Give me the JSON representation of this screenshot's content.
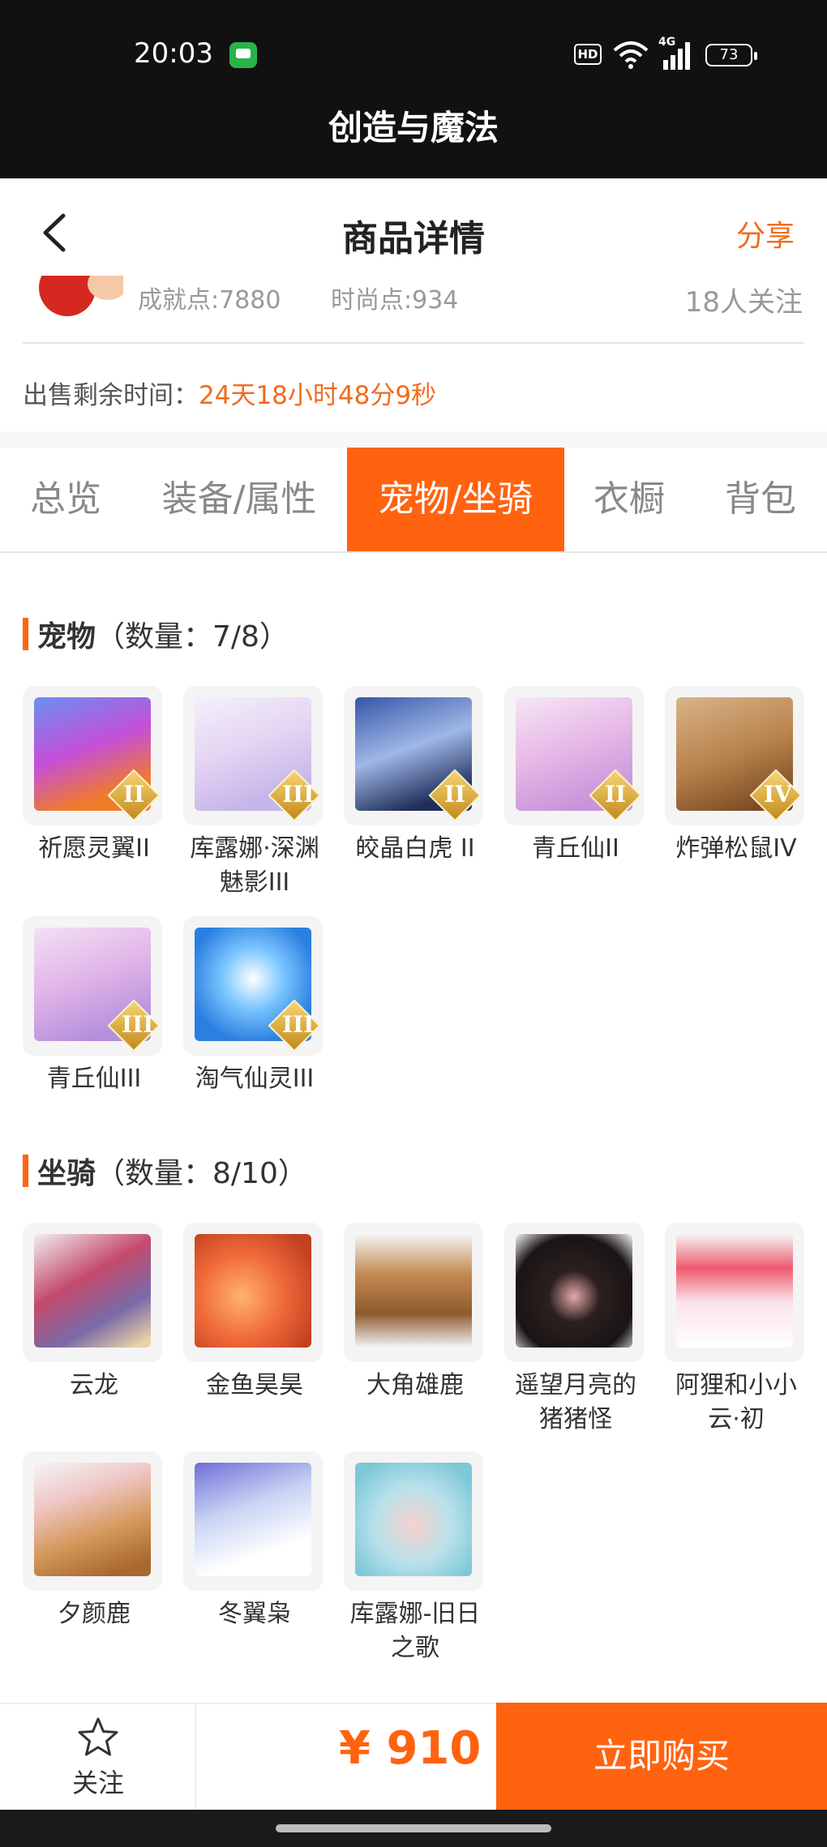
{
  "status_bar": {
    "time": "20:03",
    "hd_label": "HD",
    "signal_label": "4G",
    "battery": "73"
  },
  "app_bar": {
    "title": "创造与魔法"
  },
  "nav": {
    "title": "商品详情",
    "share": "分享"
  },
  "profile": {
    "achievement": "成就点:7880",
    "fashion": "时尚点:934",
    "followers": "18人关注"
  },
  "sale": {
    "label": "出售剩余时间：",
    "remaining": "24天18小时48分9秒"
  },
  "tabs": [
    "总览",
    "装备/属性",
    "宠物/坐骑",
    "衣橱",
    "背包"
  ],
  "active_tab": "宠物/坐骑",
  "pets": {
    "title": "宠物",
    "count": "（数量：7/8）",
    "items": [
      {
        "name": "祈愿灵翼II",
        "rank": "II"
      },
      {
        "name": "库露娜·深渊魅影III",
        "rank": "III"
      },
      {
        "name": "皎晶白虎 II",
        "rank": "II"
      },
      {
        "name": "青丘仙II",
        "rank": "II"
      },
      {
        "name": "炸弹松鼠IV",
        "rank": "IV"
      },
      {
        "name": "青丘仙III",
        "rank": "III"
      },
      {
        "name": "淘气仙灵III",
        "rank": "III"
      }
    ]
  },
  "mounts": {
    "title": "坐骑",
    "count": "（数量：8/10）",
    "items": [
      {
        "name": "云龙"
      },
      {
        "name": "金鱼昊昊"
      },
      {
        "name": "大角雄鹿"
      },
      {
        "name": "遥望月亮的猪猪怪"
      },
      {
        "name": "阿狸和小小云·初"
      },
      {
        "name": "夕颜鹿"
      },
      {
        "name": "冬翼枭"
      },
      {
        "name": "库露娜-旧日之歌"
      }
    ]
  },
  "bottom": {
    "follow": "关注",
    "price": "¥ 910",
    "buy": "立即购买"
  },
  "colors": {
    "accent": "#ff6310",
    "share": "#f26b1d"
  }
}
